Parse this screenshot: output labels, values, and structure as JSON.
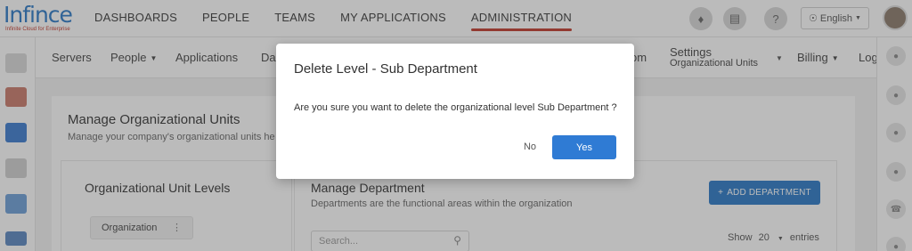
{
  "app": {
    "logo_text": "Infince",
    "logo_tagline": "Infinite Cloud for Enterprise"
  },
  "nav": {
    "items": [
      "DASHBOARDS",
      "PEOPLE",
      "TEAMS",
      "MY APPLICATIONS",
      "ADMINISTRATION"
    ],
    "active": "ADMINISTRATION",
    "language": "English"
  },
  "subnav": {
    "servers": "Servers",
    "people": "People",
    "applications": "Applications",
    "partial_da": "Da",
    "partial_om": "om",
    "settings": "Settings",
    "settings_sub": "Organizational Units",
    "billing": "Billing",
    "partial_log": "Log"
  },
  "page": {
    "title": "Manage Organizational Units",
    "subtitle": "Manage your company's organizational units he"
  },
  "levels": {
    "title": "Organizational Unit Levels",
    "items": [
      "Organization"
    ]
  },
  "department": {
    "title": "Manage Department",
    "subtitle": "Departments are the functional areas within the organization",
    "add_button": "ADD DEPARTMENT",
    "search_placeholder": "Search...",
    "show_label": "Show",
    "show_value": "20",
    "entries_label": "entries"
  },
  "modal": {
    "title": "Delete Level - Sub Department",
    "message": "Are you sure you want to delete the organizational level Sub Department ?",
    "no_label": "No",
    "yes_label": "Yes"
  },
  "colors": {
    "accent": "#2f7bd4",
    "active_underline": "#c0392b"
  },
  "icons": {
    "left_sidebar": [
      "folder-icon",
      "mail-icon",
      "calendar-icon",
      "checklist-icon",
      "image-icon",
      "edit-icon"
    ],
    "right_sidebar": [
      "chat-icon",
      "user-icon",
      "user-group-icon",
      "users-icon",
      "phone-icon",
      "calendar-icon"
    ]
  }
}
